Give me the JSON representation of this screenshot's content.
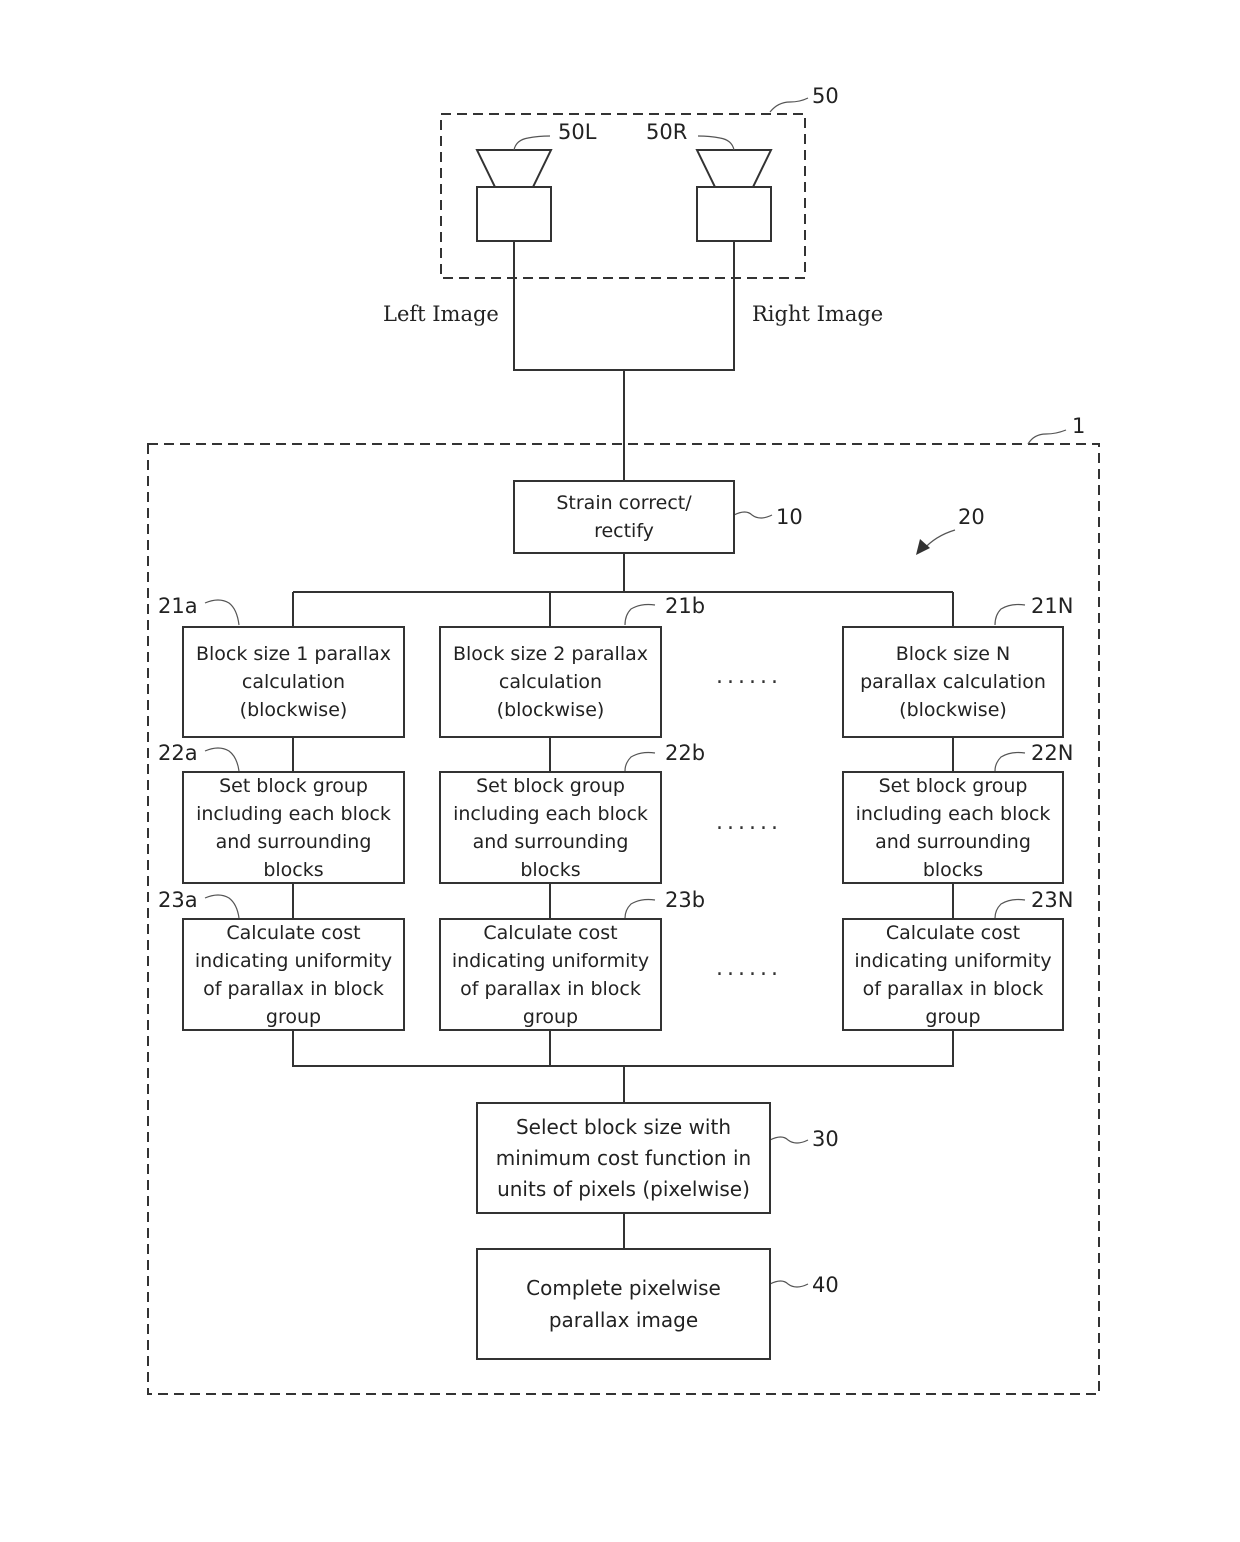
{
  "camera_unit": {
    "ref": "50",
    "left_camera_ref": "50L",
    "right_camera_ref": "50R"
  },
  "signals": {
    "left": "Left Image",
    "right": "Right Image"
  },
  "device": {
    "ref": "1",
    "group_ref": "20"
  },
  "rectify": {
    "ref": "10",
    "text": "Strain correct/\nrectify"
  },
  "columns": [
    {
      "parallax": {
        "ref": "21a",
        "text": "Block size 1 parallax\ncalculation\n(blockwise)"
      },
      "group": {
        "ref": "22a",
        "text": "Set block group\nincluding each block\nand surrounding\nblocks"
      },
      "cost": {
        "ref": "23a",
        "text": "Calculate cost\nindicating uniformity\nof parallax in block\ngroup"
      }
    },
    {
      "parallax": {
        "ref": "21b",
        "text": "Block size 2 parallax\ncalculation\n(blockwise)"
      },
      "group": {
        "ref": "22b",
        "text": "Set block group\nincluding each block\nand surrounding\nblocks"
      },
      "cost": {
        "ref": "23b",
        "text": "Calculate cost\nindicating uniformity\nof parallax in block\ngroup"
      }
    },
    {
      "parallax": {
        "ref": "21N",
        "text": "Block size N\nparallax calculation\n(blockwise)"
      },
      "group": {
        "ref": "22N",
        "text": "Set block group\nincluding each block\nand surrounding\nblocks"
      },
      "cost": {
        "ref": "23N",
        "text": "Calculate cost\nindicating uniformity\nof parallax in block\ngroup"
      }
    }
  ],
  "ellipsis": "......",
  "select": {
    "ref": "30",
    "text": "Select block size with\nminimum cost function in\nunits of pixels (pixelwise)"
  },
  "complete": {
    "ref": "40",
    "text": "Complete pixelwise\nparallax image"
  }
}
